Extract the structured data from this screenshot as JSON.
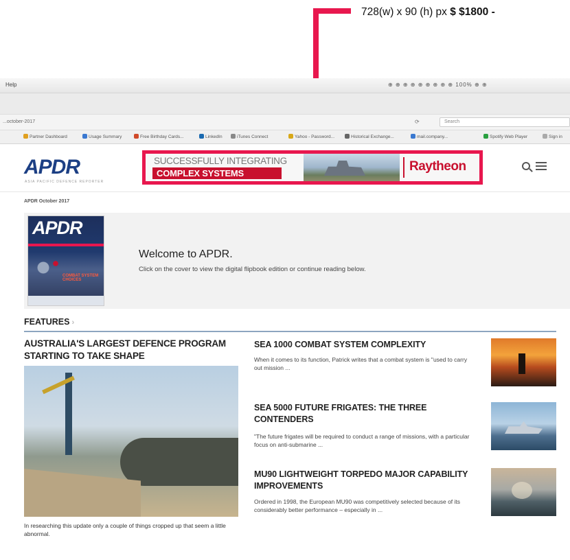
{
  "annotation": {
    "size_text": "728(w) x 90 (h) px",
    "price_text": "$ $1800 -",
    "color": "#e8174e"
  },
  "browser": {
    "menu_help": "Help",
    "tray": "⊕ ⊕ ⊕ ⊕ ⊕ ⊕ ⊕ ⊕ ⊕ 100% ⊕ ⊕",
    "url_text": "...october-2017",
    "search_placeholder": "Search",
    "bookmarks": [
      "Partner Dashboard",
      "Usage Summary",
      "Free Birthday Cards...",
      "LinkedIn",
      "iTunes Connect",
      "Yahoo - Password...",
      "Historical Exchange...",
      "mail.company...",
      "Spotify Web Player",
      "Sign in"
    ]
  },
  "header": {
    "logo": "APDR",
    "logo_sub": "ASIA PACIFIC DEFENCE REPORTER",
    "ad": {
      "line1": "SUCCESSFULLY INTEGRATING",
      "line2": "COMPLEX SYSTEMS",
      "brand": "Raytheon"
    }
  },
  "issue_label": "APDR October 2017",
  "welcome": {
    "cover_logo": "APDR",
    "cover_text": "COMBAT SYSTEM CHOICES",
    "title": "Welcome to APDR.",
    "text": "Click on the cover to view the digital flipbook edition or continue reading below."
  },
  "features": {
    "heading": "FEATURES",
    "lead": {
      "title": "AUSTRALIA'S LARGEST DEFENCE PROGRAM STARTING TO TAKE SHAPE",
      "body": "In researching this update only a couple of things cropped up that seem a little abnormal."
    },
    "articles": [
      {
        "title": "SEA 1000 COMBAT SYSTEM COMPLEXITY",
        "summary": "When it comes to its function, Patrick writes that a combat system is \"used to carry out mission ..."
      },
      {
        "title": "SEA 5000 FUTURE FRIGATES: THE THREE CONTENDERS",
        "summary": "\"The future frigates will be required to conduct a range of missions, with a particular focus on anti-submarine ..."
      },
      {
        "title": "MU90 LIGHTWEIGHT TORPEDO MAJOR CAPABILITY IMPROVEMENTS",
        "summary": "Ordered in 1998, the European MU90 was competitively selected because of its considerably better performance – especially in ..."
      }
    ]
  }
}
